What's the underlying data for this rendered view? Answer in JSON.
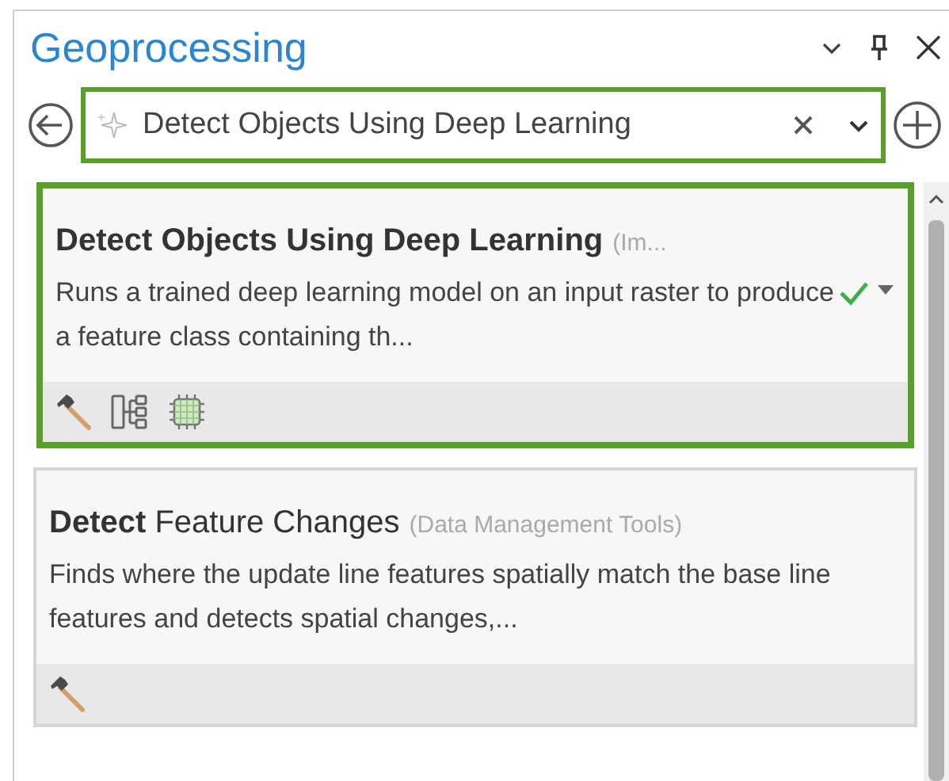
{
  "pane": {
    "title": "Geoprocessing"
  },
  "search": {
    "value": "Detect Objects Using Deep Learning"
  },
  "results": [
    {
      "title": "**Detect Objects Using Deep Learning**",
      "toolbox": "(Im...",
      "description": "Runs a trained deep learning model on an input raster to produce a feature class containing th...",
      "selected": true,
      "checked": true,
      "badges": [
        {
          "kind": "tool"
        },
        {
          "kind": "model"
        },
        {
          "kind": "gpu"
        }
      ]
    },
    {
      "title": "**Detect** Feature Changes",
      "toolbox": "(Data Management Tools)",
      "description": "Finds where the update line features spatially match the base line features and detects spatial changes,...",
      "selected": false,
      "checked": false,
      "badges": [
        {
          "kind": "tool"
        }
      ]
    }
  ]
}
